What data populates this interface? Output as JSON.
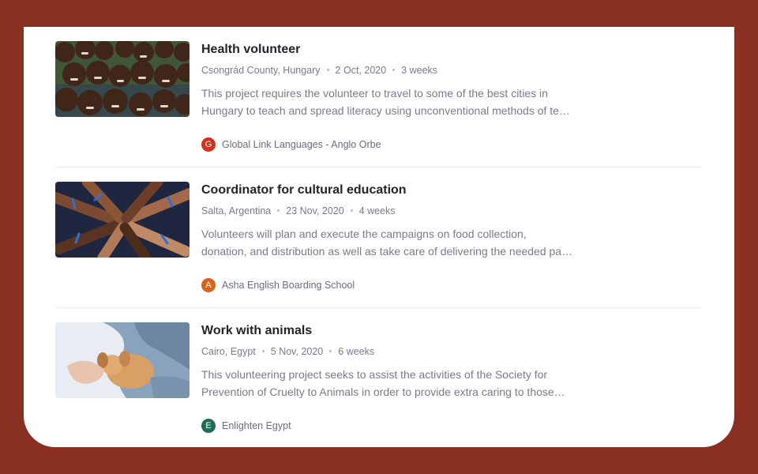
{
  "colors": {
    "background": "#8a3022",
    "card": "#ffffff",
    "title": "#23232b",
    "muted_text": "#7a7a8c"
  },
  "projects": [
    {
      "title": "Health volunteer",
      "location": "Csongrád County, Hungary",
      "date": "2 Oct, 2020",
      "duration": "3 weeks",
      "description_line1": "This project requires the volunteer to travel to some of the best cities in",
      "description_line2": "Hungary to teach and spread literacy using unconventional methods of te…",
      "organization": {
        "initial": "G",
        "name": "Global Link Languages - Anglo Orbe",
        "color": "#d1321e"
      },
      "thumbnail_icon": "group-of-children-photo"
    },
    {
      "title": "Coordinator for cultural education",
      "location": "Salta, Argentina",
      "date": "23 Nov, 2020",
      "duration": "4 weeks",
      "description_line1": "Volunteers will plan and execute the campaigns on food collection,",
      "description_line2": "donation, and distribution as well as take care of delivering the needed pa…",
      "organization": {
        "initial": "A",
        "name": "Asha English Boarding School",
        "color": "#d9641f"
      },
      "thumbnail_icon": "stacked-hands-photo"
    },
    {
      "title": "Work with animals",
      "location": "Cairo, Egypt",
      "date": "5 Nov, 2020",
      "duration": "6 weeks",
      "description_line1": "This volunteering project seeks to assist the activities of the Society for",
      "description_line2": "Prevention of Cruelty to Animals in order to provide extra caring to those…",
      "organization": {
        "initial": "E",
        "name": "Enlighten Egypt",
        "color": "#1f6b55"
      },
      "thumbnail_icon": "puppy-in-arms-photo"
    }
  ]
}
